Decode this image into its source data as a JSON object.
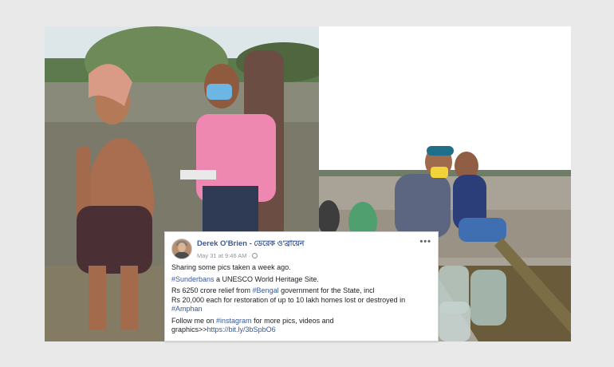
{
  "post": {
    "author": "Derek O'Brien - ডেরেক ও'ব্রায়েন",
    "timestamp": "May 31 at 9:46 AM",
    "more_label": "•••",
    "line1": "Sharing some pics taken a week ago.",
    "line2_tag": "#Sunderbans",
    "line2_rest": " a UNESCO World Heritage Site.",
    "line3_a": "Rs 6250 crore relief from ",
    "line3_tag": "#Bengal",
    "line3_b": " government for the State, incl",
    "line4": "Rs 20,000 each for restoration of up to 10 lakh homes lost or destroyed in",
    "line5_tag": "#Amphan",
    "line6_a": "Follow me on ",
    "line6_tag": "#instagram",
    "line6_b": " for more pics, videos and graphics>>",
    "line6_link": "https://bit.ly/3bSpbO6",
    "icons": {
      "globe": "globe-icon",
      "more": "more-options-icon"
    }
  },
  "colors": {
    "link": "#385898",
    "text": "#1c1e21",
    "muted": "#90949c",
    "frame": "#e9e9e9"
  }
}
